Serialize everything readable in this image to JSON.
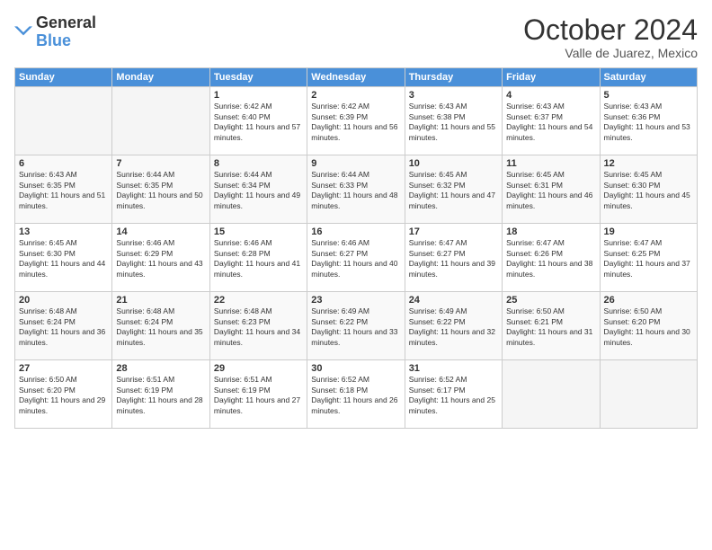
{
  "header": {
    "logo_general": "General",
    "logo_blue": "Blue",
    "title": "October 2024",
    "location": "Valle de Juarez, Mexico"
  },
  "days_of_week": [
    "Sunday",
    "Monday",
    "Tuesday",
    "Wednesday",
    "Thursday",
    "Friday",
    "Saturday"
  ],
  "weeks": [
    [
      {
        "day": "",
        "sunrise": "",
        "sunset": "",
        "daylight": "",
        "empty": true
      },
      {
        "day": "",
        "sunrise": "",
        "sunset": "",
        "daylight": "",
        "empty": true
      },
      {
        "day": "1",
        "sunrise": "Sunrise: 6:42 AM",
        "sunset": "Sunset: 6:40 PM",
        "daylight": "Daylight: 11 hours and 57 minutes."
      },
      {
        "day": "2",
        "sunrise": "Sunrise: 6:42 AM",
        "sunset": "Sunset: 6:39 PM",
        "daylight": "Daylight: 11 hours and 56 minutes."
      },
      {
        "day": "3",
        "sunrise": "Sunrise: 6:43 AM",
        "sunset": "Sunset: 6:38 PM",
        "daylight": "Daylight: 11 hours and 55 minutes."
      },
      {
        "day": "4",
        "sunrise": "Sunrise: 6:43 AM",
        "sunset": "Sunset: 6:37 PM",
        "daylight": "Daylight: 11 hours and 54 minutes."
      },
      {
        "day": "5",
        "sunrise": "Sunrise: 6:43 AM",
        "sunset": "Sunset: 6:36 PM",
        "daylight": "Daylight: 11 hours and 53 minutes."
      }
    ],
    [
      {
        "day": "6",
        "sunrise": "Sunrise: 6:43 AM",
        "sunset": "Sunset: 6:35 PM",
        "daylight": "Daylight: 11 hours and 51 minutes."
      },
      {
        "day": "7",
        "sunrise": "Sunrise: 6:44 AM",
        "sunset": "Sunset: 6:35 PM",
        "daylight": "Daylight: 11 hours and 50 minutes."
      },
      {
        "day": "8",
        "sunrise": "Sunrise: 6:44 AM",
        "sunset": "Sunset: 6:34 PM",
        "daylight": "Daylight: 11 hours and 49 minutes."
      },
      {
        "day": "9",
        "sunrise": "Sunrise: 6:44 AM",
        "sunset": "Sunset: 6:33 PM",
        "daylight": "Daylight: 11 hours and 48 minutes."
      },
      {
        "day": "10",
        "sunrise": "Sunrise: 6:45 AM",
        "sunset": "Sunset: 6:32 PM",
        "daylight": "Daylight: 11 hours and 47 minutes."
      },
      {
        "day": "11",
        "sunrise": "Sunrise: 6:45 AM",
        "sunset": "Sunset: 6:31 PM",
        "daylight": "Daylight: 11 hours and 46 minutes."
      },
      {
        "day": "12",
        "sunrise": "Sunrise: 6:45 AM",
        "sunset": "Sunset: 6:30 PM",
        "daylight": "Daylight: 11 hours and 45 minutes."
      }
    ],
    [
      {
        "day": "13",
        "sunrise": "Sunrise: 6:45 AM",
        "sunset": "Sunset: 6:30 PM",
        "daylight": "Daylight: 11 hours and 44 minutes."
      },
      {
        "day": "14",
        "sunrise": "Sunrise: 6:46 AM",
        "sunset": "Sunset: 6:29 PM",
        "daylight": "Daylight: 11 hours and 43 minutes."
      },
      {
        "day": "15",
        "sunrise": "Sunrise: 6:46 AM",
        "sunset": "Sunset: 6:28 PM",
        "daylight": "Daylight: 11 hours and 41 minutes."
      },
      {
        "day": "16",
        "sunrise": "Sunrise: 6:46 AM",
        "sunset": "Sunset: 6:27 PM",
        "daylight": "Daylight: 11 hours and 40 minutes."
      },
      {
        "day": "17",
        "sunrise": "Sunrise: 6:47 AM",
        "sunset": "Sunset: 6:27 PM",
        "daylight": "Daylight: 11 hours and 39 minutes."
      },
      {
        "day": "18",
        "sunrise": "Sunrise: 6:47 AM",
        "sunset": "Sunset: 6:26 PM",
        "daylight": "Daylight: 11 hours and 38 minutes."
      },
      {
        "day": "19",
        "sunrise": "Sunrise: 6:47 AM",
        "sunset": "Sunset: 6:25 PM",
        "daylight": "Daylight: 11 hours and 37 minutes."
      }
    ],
    [
      {
        "day": "20",
        "sunrise": "Sunrise: 6:48 AM",
        "sunset": "Sunset: 6:24 PM",
        "daylight": "Daylight: 11 hours and 36 minutes."
      },
      {
        "day": "21",
        "sunrise": "Sunrise: 6:48 AM",
        "sunset": "Sunset: 6:24 PM",
        "daylight": "Daylight: 11 hours and 35 minutes."
      },
      {
        "day": "22",
        "sunrise": "Sunrise: 6:48 AM",
        "sunset": "Sunset: 6:23 PM",
        "daylight": "Daylight: 11 hours and 34 minutes."
      },
      {
        "day": "23",
        "sunrise": "Sunrise: 6:49 AM",
        "sunset": "Sunset: 6:22 PM",
        "daylight": "Daylight: 11 hours and 33 minutes."
      },
      {
        "day": "24",
        "sunrise": "Sunrise: 6:49 AM",
        "sunset": "Sunset: 6:22 PM",
        "daylight": "Daylight: 11 hours and 32 minutes."
      },
      {
        "day": "25",
        "sunrise": "Sunrise: 6:50 AM",
        "sunset": "Sunset: 6:21 PM",
        "daylight": "Daylight: 11 hours and 31 minutes."
      },
      {
        "day": "26",
        "sunrise": "Sunrise: 6:50 AM",
        "sunset": "Sunset: 6:20 PM",
        "daylight": "Daylight: 11 hours and 30 minutes."
      }
    ],
    [
      {
        "day": "27",
        "sunrise": "Sunrise: 6:50 AM",
        "sunset": "Sunset: 6:20 PM",
        "daylight": "Daylight: 11 hours and 29 minutes."
      },
      {
        "day": "28",
        "sunrise": "Sunrise: 6:51 AM",
        "sunset": "Sunset: 6:19 PM",
        "daylight": "Daylight: 11 hours and 28 minutes."
      },
      {
        "day": "29",
        "sunrise": "Sunrise: 6:51 AM",
        "sunset": "Sunset: 6:19 PM",
        "daylight": "Daylight: 11 hours and 27 minutes."
      },
      {
        "day": "30",
        "sunrise": "Sunrise: 6:52 AM",
        "sunset": "Sunset: 6:18 PM",
        "daylight": "Daylight: 11 hours and 26 minutes."
      },
      {
        "day": "31",
        "sunrise": "Sunrise: 6:52 AM",
        "sunset": "Sunset: 6:17 PM",
        "daylight": "Daylight: 11 hours and 25 minutes."
      },
      {
        "day": "",
        "sunrise": "",
        "sunset": "",
        "daylight": "",
        "empty": true
      },
      {
        "day": "",
        "sunrise": "",
        "sunset": "",
        "daylight": "",
        "empty": true
      }
    ]
  ]
}
